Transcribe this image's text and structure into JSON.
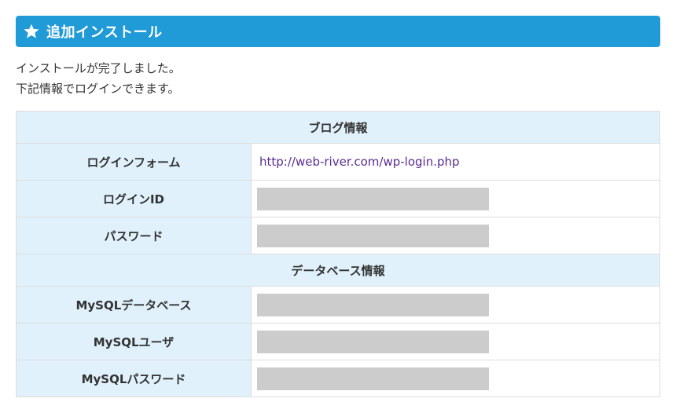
{
  "header": {
    "icon": "star-icon",
    "title": "追加インストール",
    "bg_color": "#219bd7"
  },
  "message": {
    "line1": "インストールが完了しました。",
    "line2": "下記情報でログインできます。"
  },
  "blog_info": {
    "section_title": "ブログ情報",
    "login_form_label": "ログインフォーム",
    "login_form_url": "http://web-river.com/wp-login.php",
    "login_id_label": "ログインID",
    "password_label": "パスワード"
  },
  "database_info": {
    "section_title": "データベース情報",
    "db_name_label": "MySQLデータベース",
    "db_user_label": "MySQLユーザ",
    "db_password_label": "MySQLパスワード"
  },
  "colors": {
    "label_bg": "#e0f1fb",
    "redacted": "#cccccc",
    "link": "#5a2d91"
  }
}
